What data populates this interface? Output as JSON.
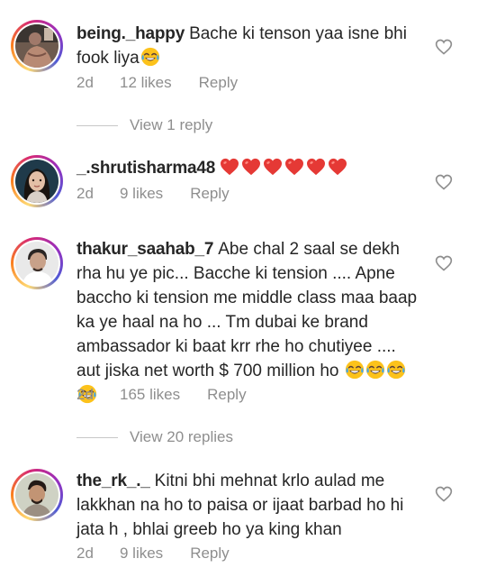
{
  "comments": [
    {
      "username": "being._happy",
      "text": "Bache ki tenson yaa isne bhi fook liya",
      "emoji": "laughing-tears",
      "time": "2d",
      "likes": "12 likes",
      "reply": "Reply",
      "view_replies": "View 1 reply"
    },
    {
      "username": "_.shrutisharma48",
      "text": "",
      "emoji": "red-heart x6",
      "time": "2d",
      "likes": "9 likes",
      "reply": "Reply"
    },
    {
      "username": "thakur_saahab_7",
      "text": "Abe chal 2 saal se dekh rha hu ye pic... Bacche ki tension .... Apne baccho ki tension me middle class maa baap ka ye haal na ho ... Tm dubai ke brand ambassador ki baat krr rhe ho chutiyee .... aut jiska net worth $ 700 million ho",
      "emoji": "laughing-tears x4",
      "time": "2d",
      "likes": "165 likes",
      "reply": "Reply",
      "view_replies": "View 20 replies"
    },
    {
      "username": "the_rk_._",
      "text": "Kitni bhi mehnat krlo aulad me lakkhan na ho to paisa or ijaat barbad ho hi jata h , bhlai greeb ho ya king khan",
      "time": "2d",
      "likes": "9 likes",
      "reply": "Reply"
    }
  ],
  "colors": {
    "text": "#262626",
    "secondary": "#8e8e8e",
    "heart_red": "#ed4956"
  },
  "icons": [
    "heart-outline-icon",
    "laughing-tears-emoji",
    "red-heart-emoji"
  ]
}
